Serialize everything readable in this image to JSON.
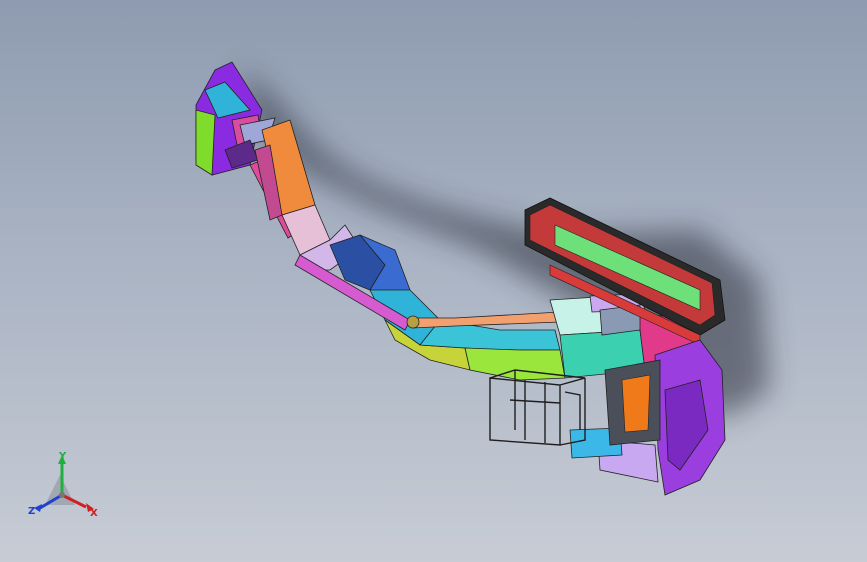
{
  "viewport": {
    "background_top": "#8e9bb0",
    "background_bottom": "#c7ccd5"
  },
  "model": {
    "description_hidden": false
  },
  "triad": {
    "x_label": "X",
    "y_label": "Y",
    "z_label": "Z",
    "x_color": "#d02020",
    "y_color": "#20b040",
    "z_color": "#2040d0"
  }
}
